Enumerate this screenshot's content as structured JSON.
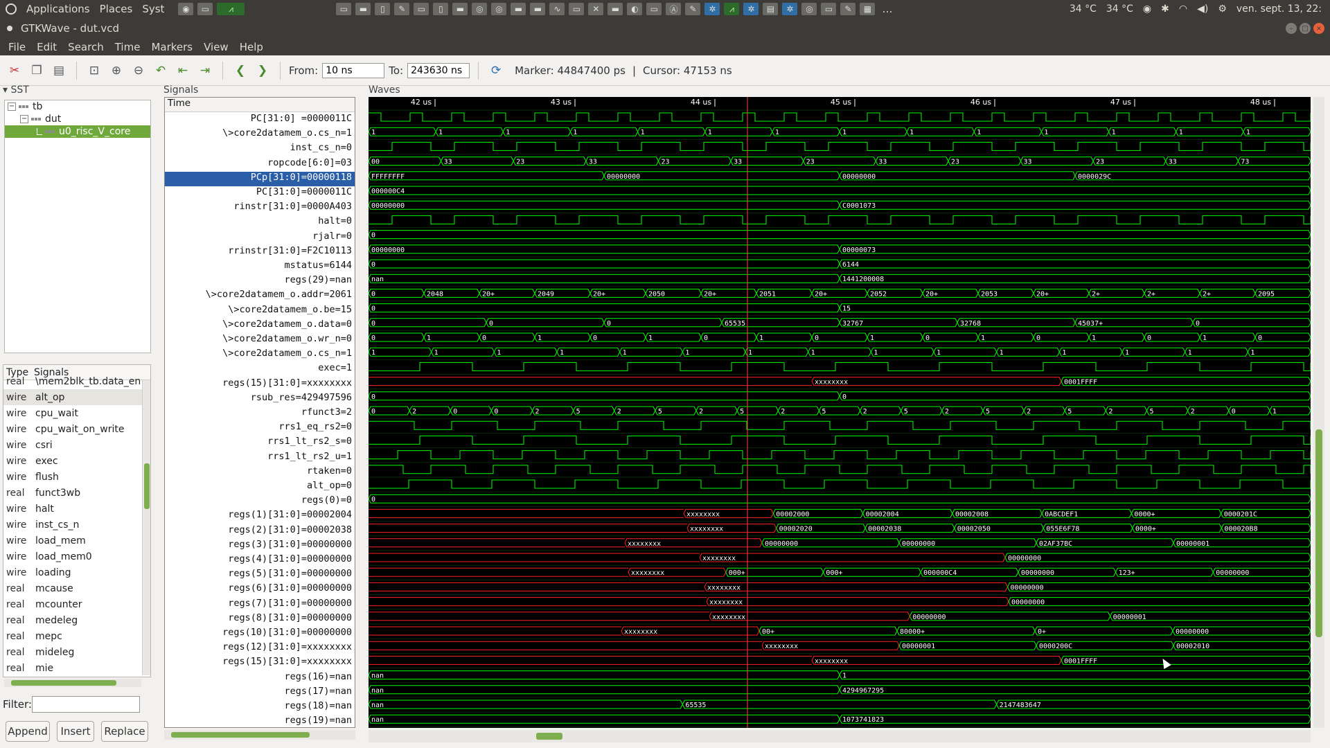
{
  "system_panel": {
    "applications": "Applications",
    "places": "Places",
    "system": "Syst",
    "temp1": "34 °C",
    "temp2": "34 °C",
    "clock": "ven. sept. 13, 22:"
  },
  "window": {
    "title": "GTKWave - dut.vcd"
  },
  "menu": [
    "File",
    "Edit",
    "Search",
    "Time",
    "Markers",
    "View",
    "Help"
  ],
  "toolbar": {
    "from_label": "From:",
    "from_value": "10 ns",
    "to_label": "To:",
    "to_value": "243630 ns",
    "marker_text": "Marker: 44847400 ps",
    "separator": "|",
    "cursor_text": "Cursor: 47153 ns"
  },
  "sst": {
    "label": "SST",
    "tree": [
      {
        "label": "tb",
        "level": 0
      },
      {
        "label": "dut",
        "level": 1
      },
      {
        "label": "u0_risc_V_core",
        "level": 2
      }
    ]
  },
  "signal_list": {
    "head_type": "Type",
    "head_signals": "Signals",
    "rows": [
      {
        "type": "real",
        "name": "\\mem2blk_tb.data_en"
      },
      {
        "type": "wire",
        "name": "alt_op"
      },
      {
        "type": "wire",
        "name": "cpu_wait"
      },
      {
        "type": "wire",
        "name": "cpu_wait_on_write"
      },
      {
        "type": "wire",
        "name": "csri"
      },
      {
        "type": "wire",
        "name": "exec"
      },
      {
        "type": "wire",
        "name": "flush"
      },
      {
        "type": "real",
        "name": "funct3wb"
      },
      {
        "type": "wire",
        "name": "halt"
      },
      {
        "type": "wire",
        "name": "inst_cs_n"
      },
      {
        "type": "wire",
        "name": "load_mem"
      },
      {
        "type": "wire",
        "name": "load_mem0"
      },
      {
        "type": "wire",
        "name": "loading"
      },
      {
        "type": "real",
        "name": "mcause"
      },
      {
        "type": "real",
        "name": "mcounter"
      },
      {
        "type": "real",
        "name": "medeleg"
      },
      {
        "type": "real",
        "name": "mepc"
      },
      {
        "type": "real",
        "name": "mideleg"
      },
      {
        "type": "real",
        "name": "mie"
      }
    ]
  },
  "filter": {
    "label": "Filter:",
    "value": ""
  },
  "buttons": {
    "append": "Append",
    "insert": "Insert",
    "replace": "Replace"
  },
  "signals_panel": {
    "label": "Signals",
    "header": "Time",
    "rows": [
      "PC[31:0] =0000011C",
      "\\>core2datamem_o.cs_n=1",
      "inst_cs_n=0",
      "ropcode[6:0]=03",
      "PCp[31:0]=00000118",
      "PC[31:0]=0000011C",
      "rinstr[31:0]=0000A403",
      "halt=0",
      "rjalr=0",
      "rrinstr[31:0]=F2C10113",
      "mstatus=6144",
      "regs(29)=nan",
      "\\>core2datamem_o.addr=2061",
      "\\>core2datamem_o.be=15",
      "\\>core2datamem_o.data=0",
      "\\>core2datamem_o.wr_n=0",
      "\\>core2datamem_o.cs_n=1",
      "exec=1",
      "regs(15)[31:0]=xxxxxxxx",
      "rsub_res=429497596",
      "rfunct3=2",
      "rrs1_eq_rs2=0",
      "rrs1_lt_rs2_s=0",
      "rrs1_lt_rs2_u=1",
      "rtaken=0",
      "alt_op=0",
      "regs(0)=0",
      "regs(1)[31:0]=00002004",
      "regs(2)[31:0]=00002038",
      "regs(3)[31:0]=00000000",
      "regs(4)[31:0]=00000000",
      "regs(5)[31:0]=00000000",
      "regs(6)[31:0]=00000000",
      "regs(7)[31:0]=00000000",
      "regs(8)[31:0]=00000000",
      "regs(10)[31:0]=00000000",
      "regs(12)[31:0]=xxxxxxxx",
      "regs(15)[31:0]=xxxxxxxx",
      "regs(16)=nan",
      "regs(17)=nan",
      "regs(18)=nan",
      "regs(19)=nan"
    ],
    "selected_index": 4
  },
  "waves": {
    "label": "Waves",
    "time_ticks": [
      "42 us",
      "43 us",
      "44 us",
      "45 us",
      "46 us",
      "47 us",
      "48 us"
    ],
    "wave_color": "#00ff00",
    "undefined_color": "#ff2020",
    "cursor_color": "#ff4040",
    "value_labels": [
      {
        "row": 1,
        "texts": [
          "1",
          "1",
          "1",
          "1",
          "1",
          "1",
          "1",
          "1",
          "1",
          "1",
          "1",
          "1",
          "1",
          "1"
        ]
      },
      {
        "row": 3,
        "texts": [
          "00",
          "33",
          "23",
          "33",
          "23",
          "33",
          "23",
          "33",
          "23",
          "33",
          "23",
          "33",
          "73"
        ]
      },
      {
        "row": 4,
        "texts": [
          "FFFFFFFF",
          "00000000",
          "00000000",
          "0000029C"
        ]
      },
      {
        "row": 5,
        "texts": [
          "000000C4"
        ]
      },
      {
        "row": 6,
        "texts": [
          "00000000",
          "C0001073"
        ]
      },
      {
        "row": 8,
        "texts": [
          "0"
        ]
      },
      {
        "row": 9,
        "texts": [
          "00000000",
          "00000073"
        ]
      },
      {
        "row": 10,
        "texts": [
          "0",
          "6144"
        ]
      },
      {
        "row": 11,
        "texts": [
          "nan",
          "1441200008"
        ]
      },
      {
        "row": 12,
        "texts": [
          "0",
          "2048",
          "20+",
          "2049",
          "20+",
          "2050",
          "20+",
          "2051",
          "20+",
          "2052",
          "20+",
          "2053",
          "20+",
          "2+",
          "2+",
          "2+",
          "2095"
        ]
      },
      {
        "row": 13,
        "texts": [
          "0",
          "15"
        ]
      },
      {
        "row": 14,
        "texts": [
          "0",
          "0",
          "0",
          "65535",
          "32767",
          "32768",
          "45037+",
          "0"
        ]
      },
      {
        "row": 15,
        "texts": [
          "0",
          "1",
          "0",
          "1",
          "0",
          "1",
          "0",
          "1",
          "0",
          "1",
          "0",
          "1",
          "0",
          "1",
          "0",
          "1",
          "0"
        ]
      },
      {
        "row": 16,
        "texts": [
          "1",
          "1",
          "1",
          "1",
          "1",
          "1",
          "1",
          "1",
          "1",
          "1",
          "1",
          "1",
          "1",
          "1",
          "1"
        ]
      },
      {
        "row": 18,
        "texts": [
          "xxxxxxxx",
          "0001FFFF"
        ]
      },
      {
        "row": 19,
        "texts": [
          "0",
          "0"
        ]
      },
      {
        "row": 20,
        "texts": [
          "0",
          "2",
          "0",
          "0",
          "2",
          "5",
          "2",
          "5",
          "2",
          "5",
          "2",
          "5",
          "2",
          "5",
          "2",
          "5",
          "2",
          "5",
          "2",
          "5",
          "2",
          "0",
          "1"
        ]
      },
      {
        "row": 26,
        "texts": [
          "0"
        ]
      },
      {
        "row": 27,
        "texts": [
          "xxxxxxxx",
          "00002000",
          "00002004",
          "00002008",
          "0ABCDEF1",
          "0000+",
          "0000201C"
        ]
      },
      {
        "row": 28,
        "texts": [
          "xxxxxxxx",
          "00002020",
          "00002038",
          "00002050",
          "055E6F78",
          "0000+",
          "000020B8"
        ]
      },
      {
        "row": 29,
        "texts": [
          "xxxxxxxx",
          "00000000",
          "00000000",
          "02AF37BC",
          "00000001"
        ]
      },
      {
        "row": 30,
        "texts": [
          "xxxxxxxx",
          "00000000"
        ]
      },
      {
        "row": 31,
        "texts": [
          "xxxxxxxx",
          "000+",
          "000+",
          "000000C4",
          "00000000",
          "123+",
          "00000000"
        ]
      },
      {
        "row": 32,
        "texts": [
          "xxxxxxxx",
          "00000000"
        ]
      },
      {
        "row": 33,
        "texts": [
          "xxxxxxxx",
          "00000000"
        ]
      },
      {
        "row": 34,
        "texts": [
          "xxxxxxxx",
          "00000000",
          "00000001"
        ]
      },
      {
        "row": 35,
        "texts": [
          "xxxxxxxx",
          "00+",
          "80000+",
          "0+",
          "00000000"
        ]
      },
      {
        "row": 36,
        "texts": [
          "xxxxxxxx",
          "00000001",
          "0000200C",
          "00002010"
        ]
      },
      {
        "row": 37,
        "texts": [
          "xxxxxxxx",
          "0001FFFF"
        ]
      },
      {
        "row": 38,
        "texts": [
          "nan",
          "1"
        ]
      },
      {
        "row": 39,
        "texts": [
          "nan",
          "4294967295"
        ]
      },
      {
        "row": 40,
        "texts": [
          "nan",
          "65535",
          "2147483647"
        ]
      },
      {
        "row": 41,
        "texts": [
          "nan",
          "1073741823"
        ]
      }
    ]
  }
}
